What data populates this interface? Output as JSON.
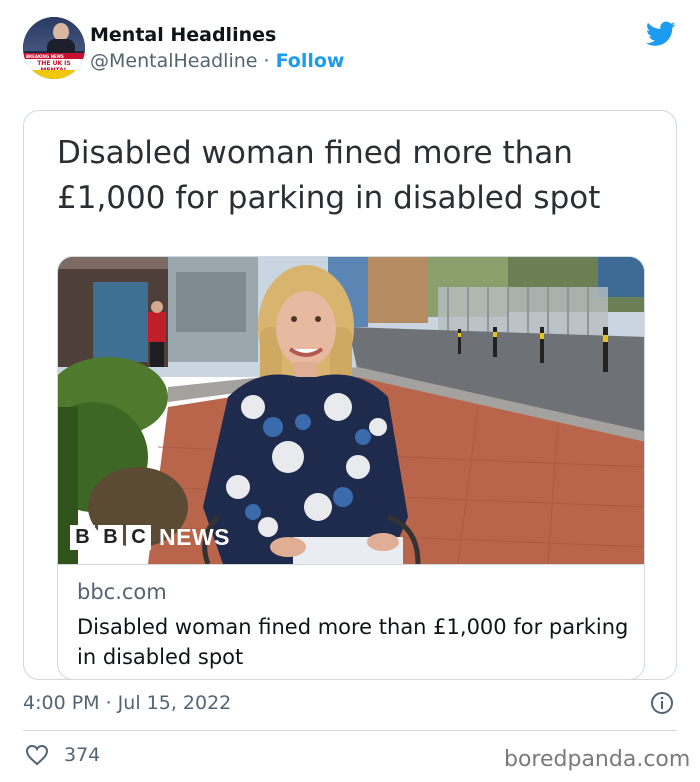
{
  "author": {
    "display_name": "Mental Headlines",
    "handle": "@MentalHeadline",
    "separator": " · ",
    "follow_label": "Follow",
    "avatar_caption": "THE UK IS MENTAL",
    "avatar_banner": "BREAKING NEWS"
  },
  "quoted_text": "Disabled woman fined more than £1,000 for parking in disabled spot",
  "link_card": {
    "domain": "bbc.com",
    "title": "Disabled woman fined more than £1,000 for parking in disabled spot",
    "image_brand": {
      "letters": [
        "B",
        "B",
        "C"
      ],
      "word": "NEWS"
    }
  },
  "timestamp": "4:00 PM · Jul 15, 2022",
  "likes": "374",
  "watermark": "boredpanda.com",
  "icons": {
    "brand": "twitter-bird-icon",
    "info": "info-icon",
    "like": "heart-icon"
  },
  "colors": {
    "accent": "#1d9bf0",
    "muted_text": "#536471",
    "border": "#cfd9de"
  }
}
